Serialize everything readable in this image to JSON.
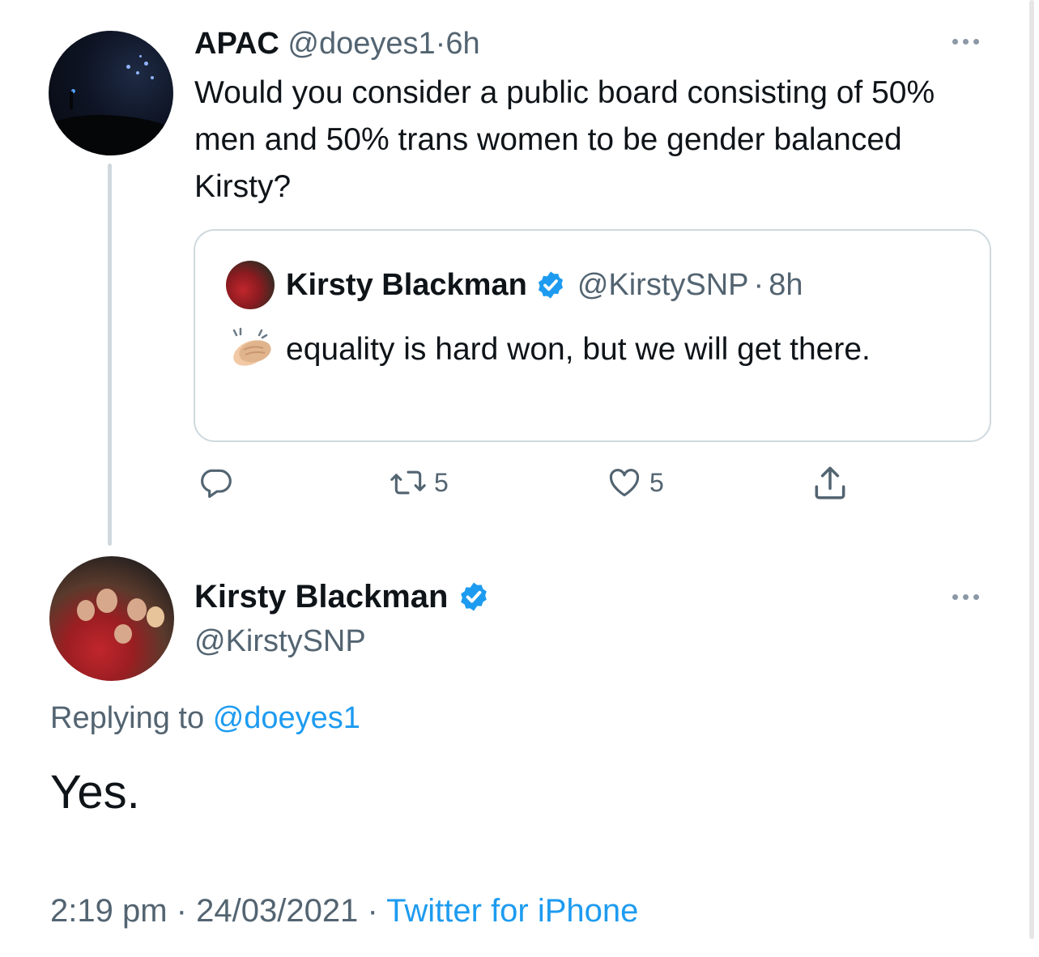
{
  "parent_tweet": {
    "display_name": "APAC",
    "handle": "@doeyes1",
    "separator": "·",
    "time": "6h",
    "text": "Would you consider a public board consisting of 50% men and 50% trans women to be gender balanced Kirsty?",
    "quoted_tweet": {
      "display_name": "Kirsty Blackman",
      "handle": "@KirstySNP",
      "separator": "·",
      "time": "8h",
      "emoji_icon": "clapping-hands-icon",
      "text": "equality is hard won, but we will get there."
    },
    "actions": {
      "reply_icon": "reply-icon",
      "retweet_count": "5",
      "like_count": "5",
      "share_icon": "share-icon"
    }
  },
  "reply_tweet": {
    "display_name": "Kirsty Blackman",
    "handle": "@KirstySNP",
    "replying_prefix": "Replying to",
    "replying_handle": "@doeyes1",
    "text": "Yes.",
    "time": "2:19 pm",
    "separator": "·",
    "date": "24/03/2021",
    "source": "Twitter for iPhone"
  },
  "colors": {
    "accent": "#1d9bf0",
    "muted_text": "#536471",
    "text": "#0f1419",
    "border": "#cfd9de"
  }
}
